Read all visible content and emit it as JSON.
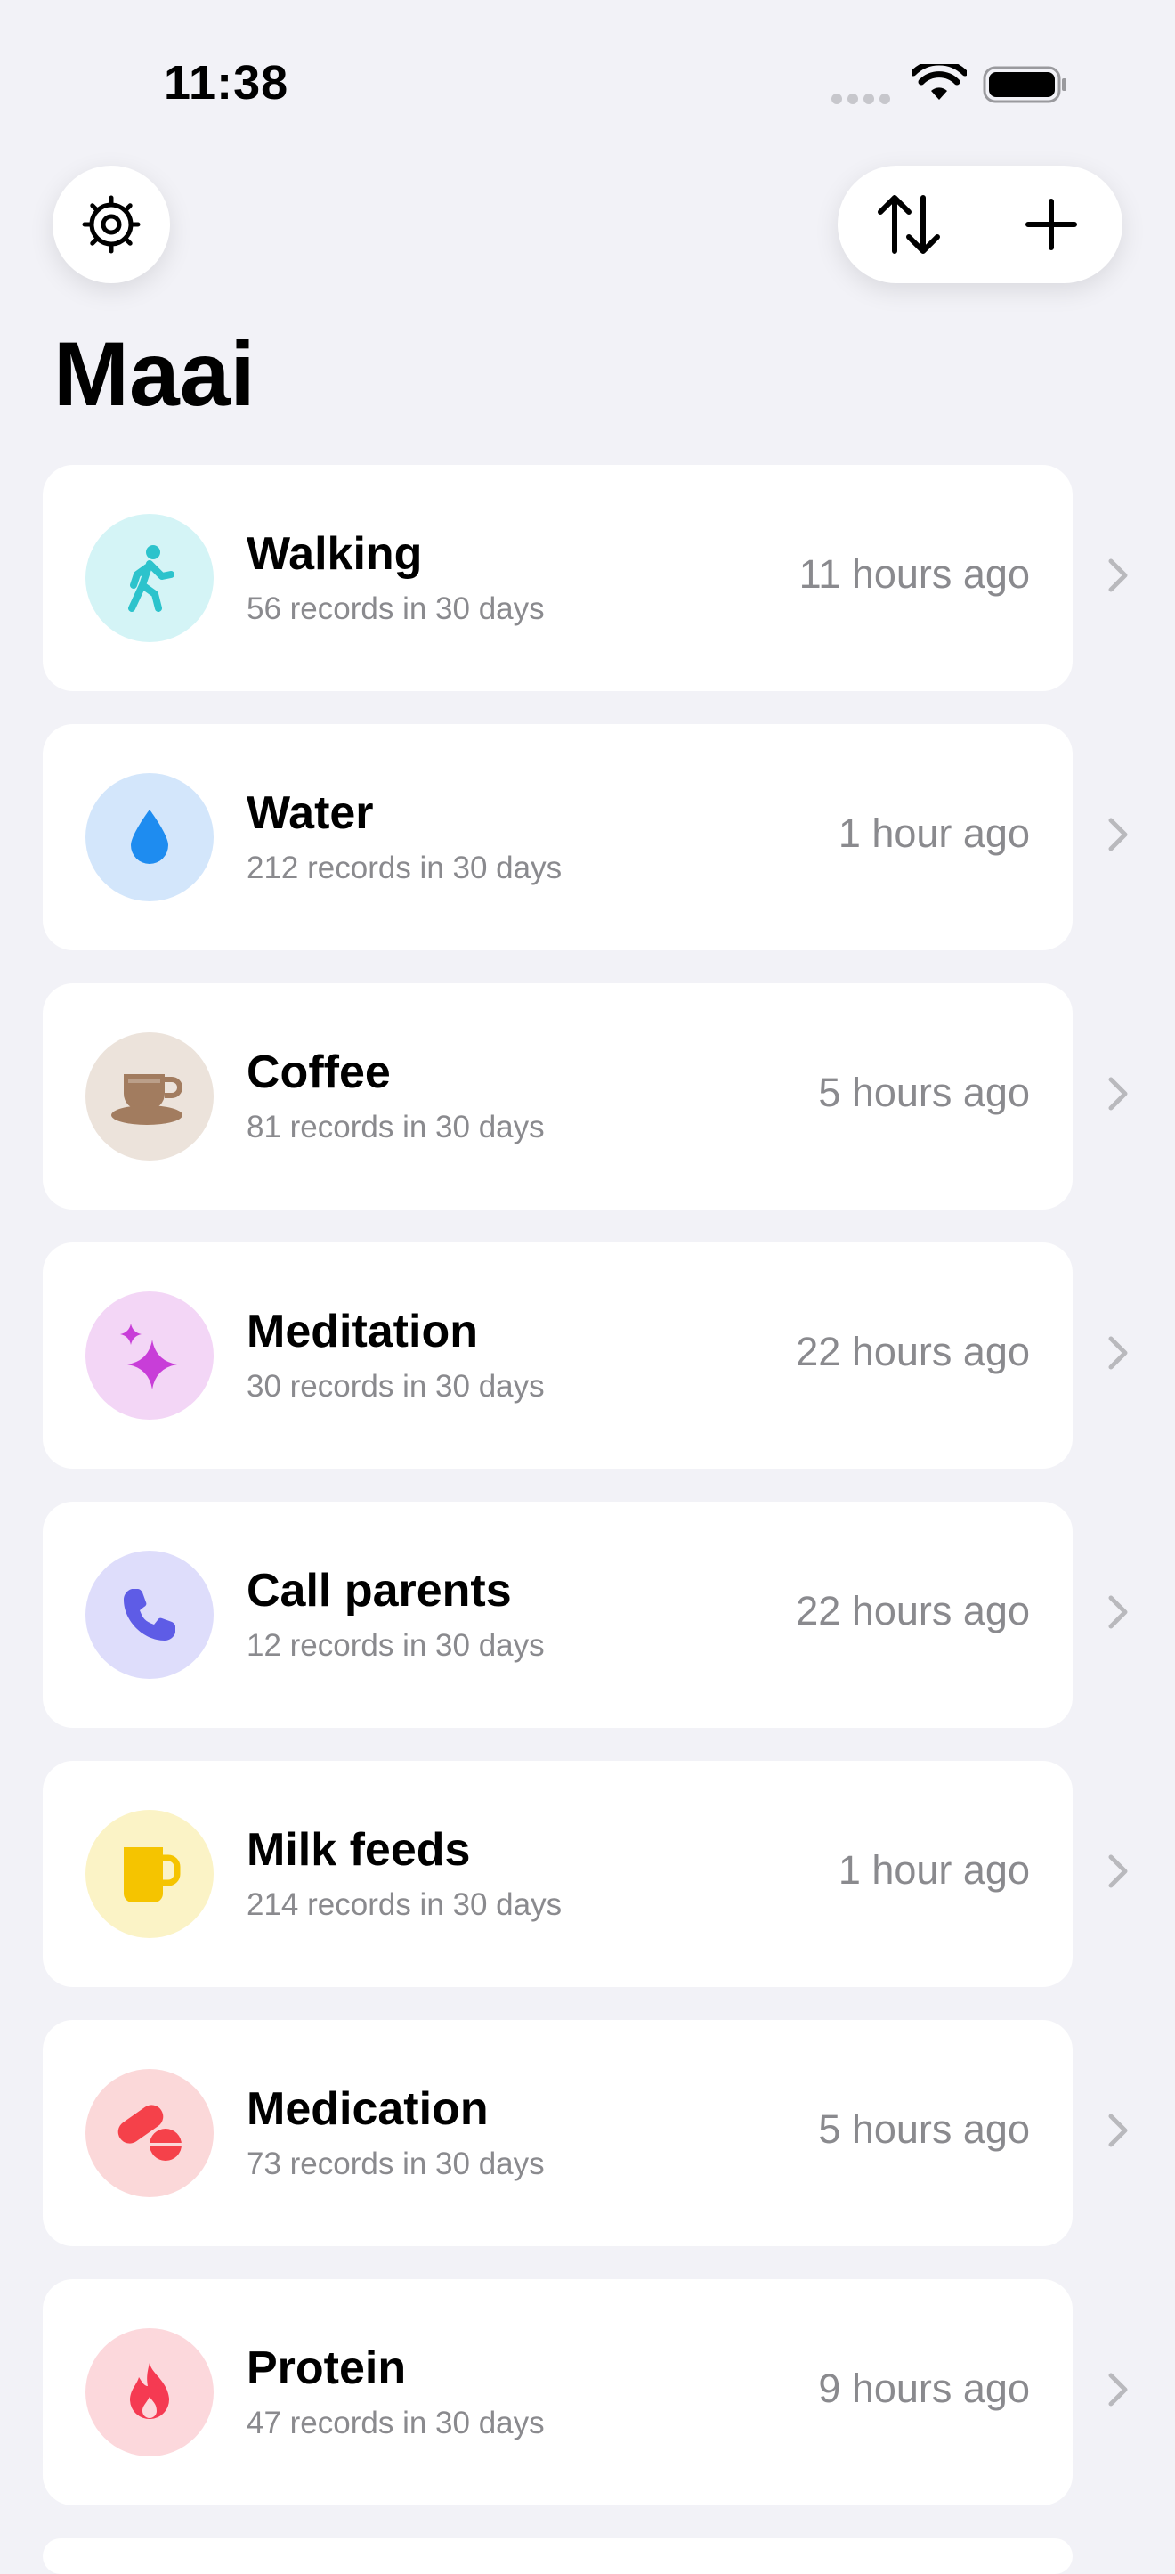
{
  "status_bar": {
    "time": "11:38"
  },
  "header": {
    "title": "Maai",
    "settings_icon": "gear-icon",
    "sort_icon": "arrow-up-down-icon",
    "add_icon": "plus-icon"
  },
  "trackers": [
    {
      "name": "Walking",
      "summary": "56 records in 30 days",
      "last": "11 hours ago",
      "icon": "figure-walk-icon",
      "icon_color": "#2cc3cc",
      "bg_color": "#d4f4f6"
    },
    {
      "name": "Water",
      "summary": "212 records in 30 days",
      "last": "1 hour ago",
      "icon": "drop-icon",
      "icon_color": "#1e8cf0",
      "bg_color": "#d3e6fb"
    },
    {
      "name": "Coffee",
      "summary": "81 records in 30 days",
      "last": "5 hours ago",
      "icon": "coffee-cup-icon",
      "icon_color": "#a27c5f",
      "bg_color": "#ece3db"
    },
    {
      "name": "Meditation",
      "summary": "30 records in 30 days",
      "last": "22 hours ago",
      "icon": "sparkles-icon",
      "icon_color": "#c83ed8",
      "bg_color": "#f3d6f6"
    },
    {
      "name": "Call parents",
      "summary": "12 records in 30 days",
      "last": "22 hours ago",
      "icon": "phone-icon",
      "icon_color": "#5e5ce6",
      "bg_color": "#deddfb"
    },
    {
      "name": "Milk feeds",
      "summary": "214 records in 30 days",
      "last": "1 hour ago",
      "icon": "mug-icon",
      "icon_color": "#f5c400",
      "bg_color": "#fbf3c6"
    },
    {
      "name": "Medication",
      "summary": "73 records in 30 days",
      "last": "5 hours ago",
      "icon": "pills-icon",
      "icon_color": "#f5414a",
      "bg_color": "#fbd8d9"
    },
    {
      "name": "Protein",
      "summary": "47 records in 30 days",
      "last": "9 hours ago",
      "icon": "flame-icon",
      "icon_color": "#f53a52",
      "bg_color": "#fcd8dc"
    }
  ]
}
